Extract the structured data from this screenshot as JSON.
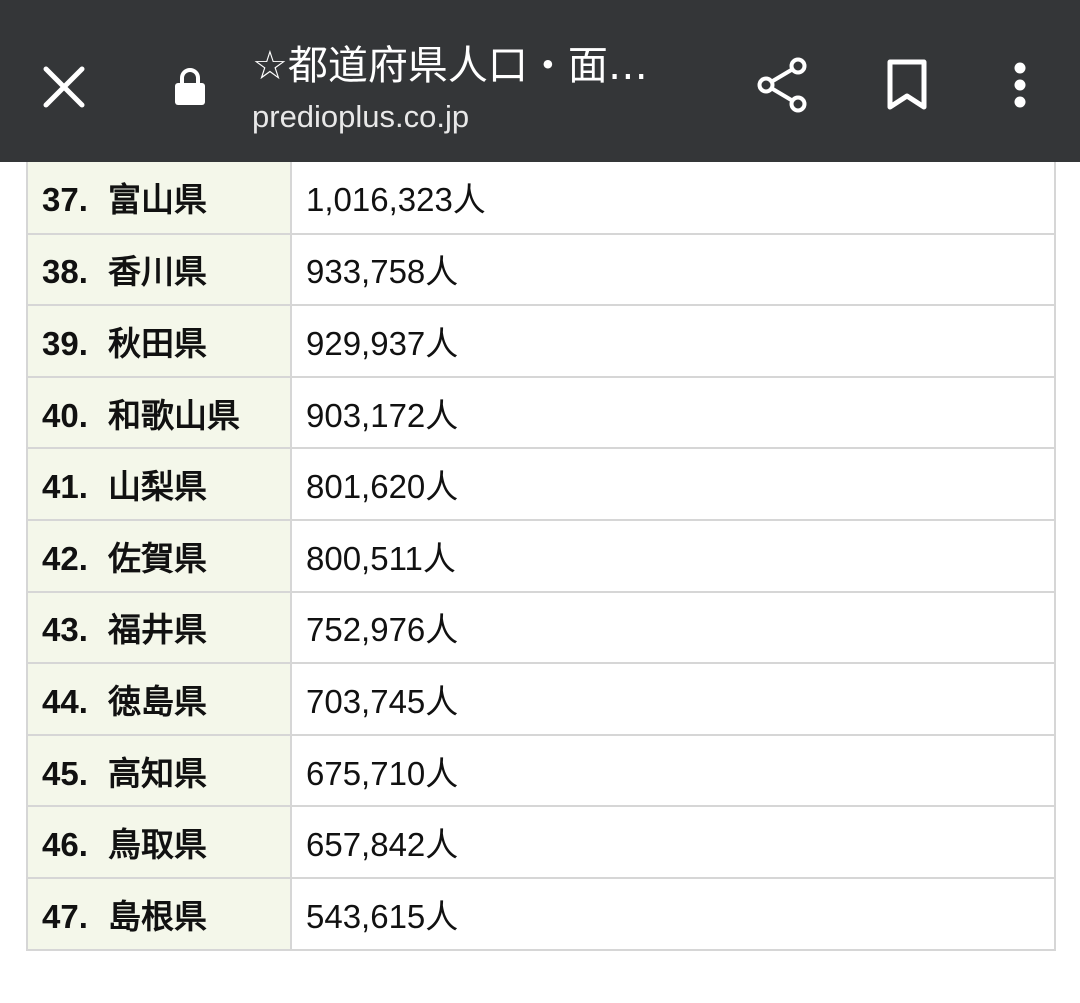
{
  "toolbar": {
    "title": "☆都道府県人口・面…",
    "url": "predioplus.co.jp",
    "icons": {
      "close": "close-icon",
      "lock": "lock-icon",
      "share": "share-icon",
      "bookmark": "bookmark-icon",
      "menu": "more-vert-icon"
    }
  },
  "table": {
    "rows": [
      {
        "rank": "37.",
        "name": "富山県",
        "population": "1,016,323人"
      },
      {
        "rank": "38.",
        "name": "香川県",
        "population": "933,758人"
      },
      {
        "rank": "39.",
        "name": "秋田県",
        "population": "929,937人"
      },
      {
        "rank": "40.",
        "name": "和歌山県",
        "population": "903,172人"
      },
      {
        "rank": "41.",
        "name": "山梨県",
        "population": "801,620人"
      },
      {
        "rank": "42.",
        "name": "佐賀県",
        "population": "800,511人"
      },
      {
        "rank": "43.",
        "name": "福井県",
        "population": "752,976人"
      },
      {
        "rank": "44.",
        "name": "徳島県",
        "population": "703,745人"
      },
      {
        "rank": "45.",
        "name": "高知県",
        "population": "675,710人"
      },
      {
        "rank": "46.",
        "name": "鳥取県",
        "population": "657,842人"
      },
      {
        "rank": "47.",
        "name": "島根県",
        "population": "543,615人"
      }
    ]
  },
  "colors": {
    "toolbar_bg": "#343638",
    "name_cell_bg": "#f4f7ea",
    "border": "#d6d6d6"
  }
}
